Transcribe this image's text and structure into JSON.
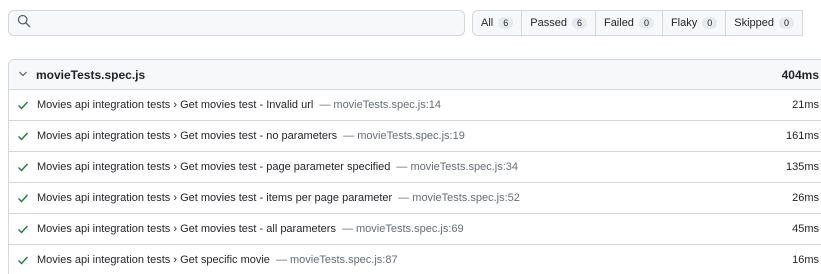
{
  "search": {
    "value": "",
    "placeholder": "",
    "icon": "search-icon"
  },
  "filters": [
    {
      "label": "All",
      "count": "6"
    },
    {
      "label": "Passed",
      "count": "6"
    },
    {
      "label": "Failed",
      "count": "0"
    },
    {
      "label": "Flaky",
      "count": "0"
    },
    {
      "label": "Skipped",
      "count": "0"
    }
  ],
  "file": {
    "name": "movieTests.spec.js",
    "duration": "404ms",
    "icon": "chevron-down-icon"
  },
  "colors": {
    "pass": "#1a7f37",
    "border": "#d0d7de",
    "muted": "#656d76"
  },
  "tests": [
    {
      "title": "Movies api integration tests › Get movies test - Invalid url",
      "location": "— movieTests.spec.js:14",
      "duration": "21ms",
      "status": "passed"
    },
    {
      "title": "Movies api integration tests › Get movies test - no parameters",
      "location": "— movieTests.spec.js:19",
      "duration": "161ms",
      "status": "passed"
    },
    {
      "title": "Movies api integration tests › Get movies test - page parameter specified",
      "location": "— movieTests.spec.js:34",
      "duration": "135ms",
      "status": "passed"
    },
    {
      "title": "Movies api integration tests › Get movies test - items per page parameter",
      "location": "— movieTests.spec.js:52",
      "duration": "26ms",
      "status": "passed"
    },
    {
      "title": "Movies api integration tests › Get movies test - all parameters",
      "location": "— movieTests.spec.js:69",
      "duration": "45ms",
      "status": "passed"
    },
    {
      "title": "Movies api integration tests › Get specific movie",
      "location": "— movieTests.spec.js:87",
      "duration": "16ms",
      "status": "passed"
    }
  ]
}
